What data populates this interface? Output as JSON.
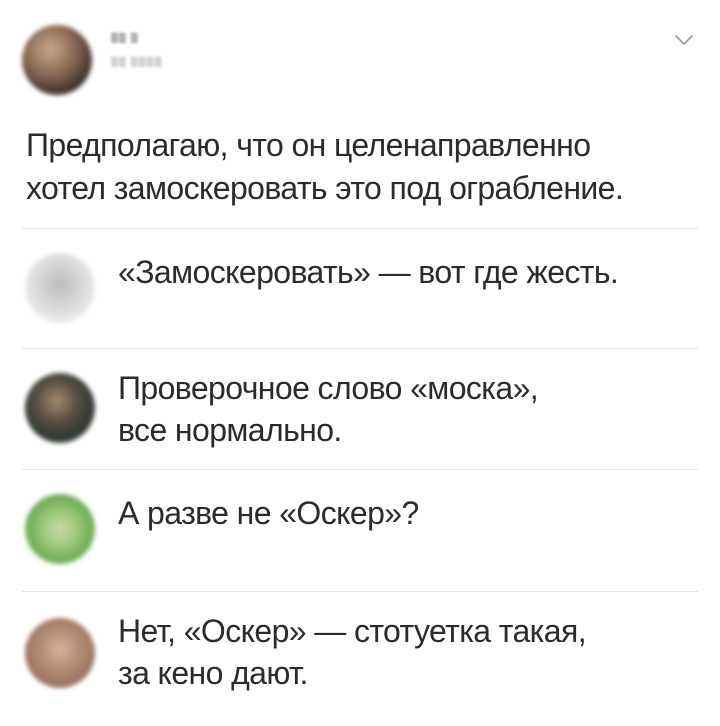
{
  "post": {
    "author_name": "▒▒ ▒",
    "author_meta": "▒▒ ▒▒▒▒",
    "text": "Предполагаю, что он целенаправленно\nхотел замоскеровать это под ограбление."
  },
  "comments": [
    {
      "text": "«Замоскеровать» — вот где жесть."
    },
    {
      "text": "Проверочное слово «моска»,\nвсе нормально."
    },
    {
      "text": "А разве не «Оскер»?"
    },
    {
      "text": "Нет, «Оскер» — стотуетка такая,\nза кено дают."
    }
  ],
  "colors": {
    "background": "#ffffff",
    "text": "#2b2b2b",
    "divider": "#e4e4e4",
    "chevron": "#9a9a9a"
  },
  "icons": {
    "menu": "chevron-down-icon"
  }
}
